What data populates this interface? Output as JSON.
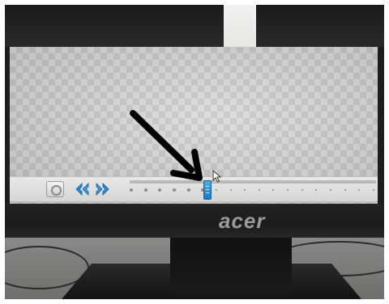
{
  "monitor": {
    "brand": "acer"
  },
  "timeline": {
    "loop_button_icon": "loop-icon",
    "prev_button_icon": "double-chevron-left-icon",
    "next_button_icon": "double-chevron-right-icon",
    "playhead_icon": "playhead-handle-icon",
    "cursor_icon": "mouse-pointer-icon",
    "playhead_frame": 6,
    "frame_count": 18
  },
  "annotation": {
    "icon": "arrow-pointer-annotation",
    "color": "#000000"
  },
  "colors": {
    "accent": "#2a8ad6",
    "screen_bg": "#dcdcda",
    "bezel": "#1a1a1a"
  }
}
